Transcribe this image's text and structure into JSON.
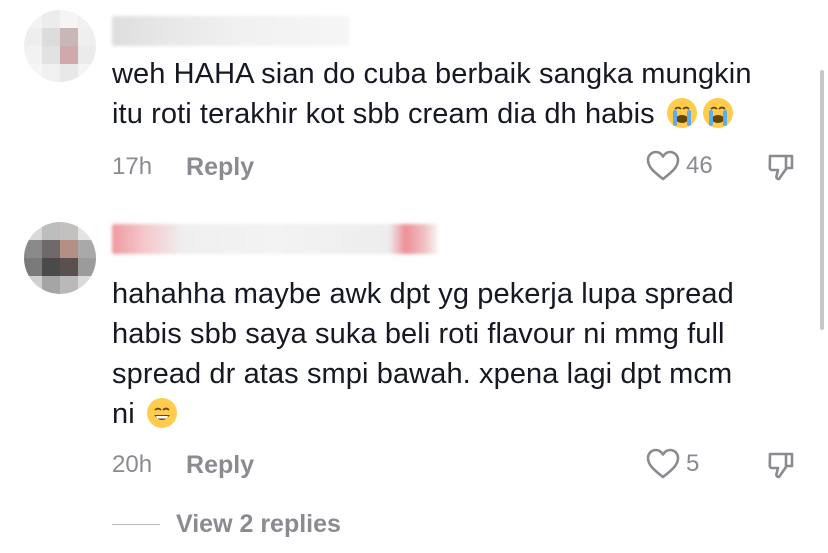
{
  "comments": [
    {
      "text": "weh HAHA sian do cuba berbaik sangka mungkin\nitu roti terakhir kot sbb cream dia dh habis",
      "emojis": [
        "loudly-crying-face",
        "loudly-crying-face"
      ],
      "time": "17h",
      "reply_label": "Reply",
      "likes": "46"
    },
    {
      "text": "hahahha maybe awk dpt yg pekerja lupa spread\nhabis sbb saya suka beli roti flavour ni mmg full\nspread dr atas smpi bawah. xpena lagi dpt mcm\nni",
      "emojis": [
        "grinning-face-with-smiling-eyes"
      ],
      "time": "20h",
      "reply_label": "Reply",
      "likes": "5"
    }
  ],
  "view_replies_label": "View 2 replies",
  "icons": {
    "like": "heart-outline-icon",
    "dislike": "thumbs-down-icon"
  },
  "colors": {
    "text_primary": "#161823",
    "text_secondary": "#8a8b91",
    "emoji_yellow": "#ffcc4d",
    "emoji_tear": "#5dadec"
  }
}
